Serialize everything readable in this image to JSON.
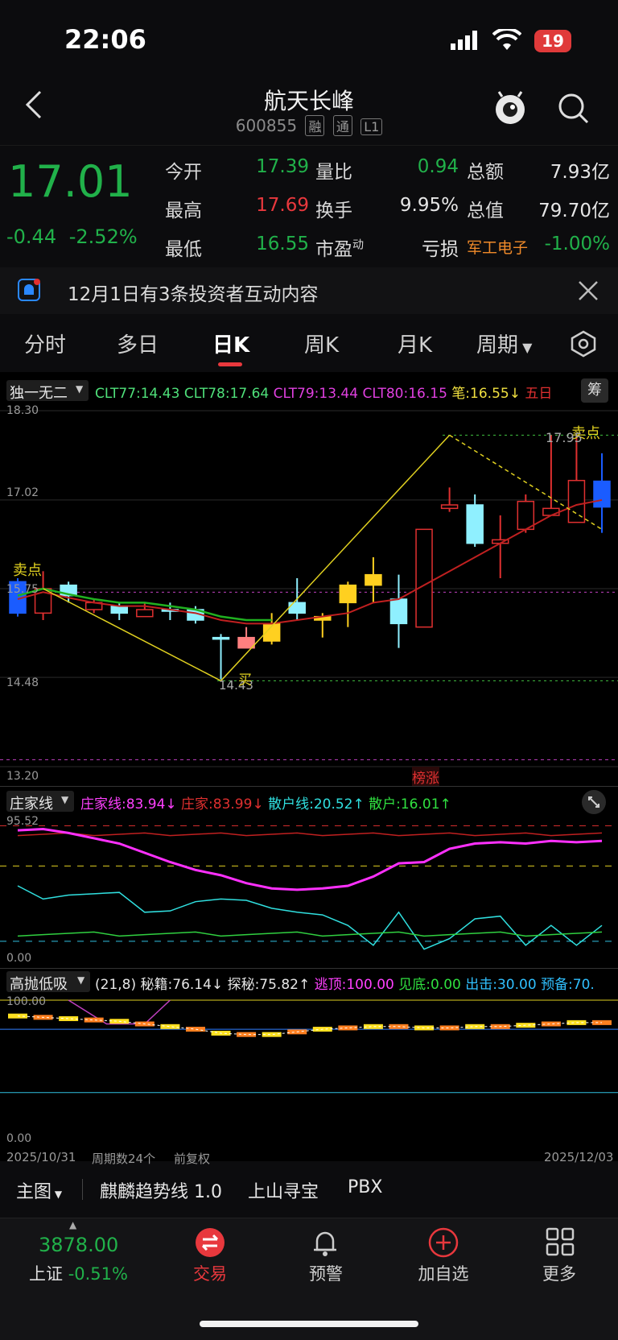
{
  "status": {
    "time": "22:06",
    "battery": "19"
  },
  "header": {
    "title": "航天长峰",
    "code": "600855",
    "tags": [
      "融",
      "通",
      "L1"
    ]
  },
  "quote": {
    "price": "17.01",
    "change": "-0.44",
    "change_pct": "-2.52%",
    "rows": [
      [
        {
          "label": "今开",
          "value": "17.39",
          "color": "green"
        },
        {
          "label": "量比",
          "value": "0.94",
          "color": "green"
        },
        {
          "label": "总额",
          "value": "7.93亿",
          "color": "white"
        }
      ],
      [
        {
          "label": "最高",
          "value": "17.69",
          "color": "red"
        },
        {
          "label": "换手",
          "value": "9.95%",
          "color": "white"
        },
        {
          "label": "总值",
          "value": "79.70亿",
          "color": "white"
        }
      ],
      [
        {
          "label": "最低",
          "value": "16.55",
          "color": "green"
        },
        {
          "label": "市盈",
          "sup": "动",
          "value": "亏损",
          "color": "white"
        },
        {
          "label": "军工电子",
          "value": "-1.00%",
          "color": "green"
        }
      ]
    ]
  },
  "notice": {
    "text": "12月1日有3条投资者互动内容"
  },
  "tabs": [
    "分时",
    "多日",
    "日K",
    "周K",
    "月K",
    "周期"
  ],
  "main_chart": {
    "indicator_name": "独一无二",
    "legend": [
      {
        "text": "CLT77:14.43",
        "color": "#4fe07a"
      },
      {
        "text": "CLT78:17.64",
        "color": "#4fe07a"
      },
      {
        "text": "CLT79:13.44",
        "color": "#e040e0"
      },
      {
        "text": "CLT80:16.15",
        "color": "#e040e0"
      },
      {
        "text": "笔:16.55↓",
        "color": "#f0e040"
      },
      {
        "text": "五日",
        "color": "#e03030"
      }
    ],
    "chip_btn": "筹",
    "y_labels": [
      "18.30",
      "17.02",
      "15.75",
      "14.48",
      "13.20"
    ],
    "annotations": {
      "sell1": "卖点",
      "sell2": "卖点",
      "high": "17.95",
      "low": "14.43",
      "buy": "买",
      "bang": "榜涨"
    }
  },
  "sub1": {
    "indicator_name": "庄家线",
    "legend": [
      {
        "text": "庄家线:83.94↓",
        "color": "#ff40ff"
      },
      {
        "text": "庄家:83.99↓",
        "color": "#e03030"
      },
      {
        "text": "散户线:20.52↑",
        "color": "#30e0e0"
      },
      {
        "text": "散户:16.01↑",
        "color": "#30e040"
      }
    ],
    "y_labels": [
      "95.52",
      "0.00"
    ]
  },
  "sub2": {
    "indicator_name": "高抛低吸",
    "legend": [
      {
        "text": "(21,8)",
        "color": "#e6e6e6"
      },
      {
        "text": "秘籍:76.14↓",
        "color": "#e6e6e6"
      },
      {
        "text": "探秘:75.82↑",
        "color": "#e6e6e6"
      },
      {
        "text": "逃顶:100.00",
        "color": "#ff40ff"
      },
      {
        "text": "见底:0.00",
        "color": "#30e040"
      },
      {
        "text": "出击:30.00",
        "color": "#30c0ff"
      },
      {
        "text": "预备:70.",
        "color": "#30c0ff"
      }
    ],
    "y_labels": [
      "100.00",
      "0.00"
    ]
  },
  "x_axis": {
    "start": "2025/10/31",
    "period": "周期数24个",
    "adjust": "前复权",
    "end": "2025/12/03"
  },
  "bottom_bar": {
    "main": "主图",
    "items": [
      "麒麟趋势线 1.0",
      "上山寻宝",
      "PBX"
    ]
  },
  "tabbar": {
    "index_value": "3878.00",
    "index_name": "上证",
    "index_change": "-0.51%",
    "items": [
      "交易",
      "预警",
      "加自选",
      "更多"
    ]
  },
  "chart_data": {
    "type": "candlestick",
    "ylim": [
      13.2,
      18.3
    ],
    "candles": [
      {
        "o": 15.4,
        "c": 15.85,
        "h": 15.9,
        "l": 15.35,
        "up": false
      },
      {
        "o": 15.75,
        "c": 15.4,
        "h": 16.0,
        "l": 15.3,
        "up": true
      },
      {
        "o": 15.65,
        "c": 15.8,
        "h": 15.85,
        "l": 15.55,
        "up": false
      },
      {
        "o": 15.55,
        "c": 15.45,
        "h": 15.6,
        "l": 15.4,
        "up": true
      },
      {
        "o": 15.5,
        "c": 15.4,
        "h": 15.55,
        "l": 15.3,
        "up": false
      },
      {
        "o": 15.45,
        "c": 15.35,
        "h": 15.55,
        "l": 15.35,
        "up": true
      },
      {
        "o": 15.45,
        "c": 15.45,
        "h": 15.55,
        "l": 15.3,
        "up": false
      },
      {
        "o": 15.45,
        "c": 15.3,
        "h": 15.5,
        "l": 15.25,
        "up": false
      },
      {
        "o": 15.05,
        "c": 15.05,
        "h": 15.1,
        "l": 14.45,
        "up": false
      },
      {
        "o": 14.9,
        "c": 15.05,
        "h": 15.2,
        "l": 14.9,
        "up": true
      },
      {
        "o": 15.0,
        "c": 15.25,
        "h": 15.4,
        "l": 14.95,
        "up": true
      },
      {
        "o": 15.4,
        "c": 15.55,
        "h": 15.9,
        "l": 15.3,
        "up": false
      },
      {
        "o": 15.3,
        "c": 15.35,
        "h": 15.4,
        "l": 15.05,
        "up": true
      },
      {
        "o": 15.55,
        "c": 15.8,
        "h": 15.85,
        "l": 15.2,
        "up": true
      },
      {
        "o": 15.8,
        "c": 15.95,
        "h": 16.2,
        "l": 15.55,
        "up": true
      },
      {
        "o": 15.6,
        "c": 15.25,
        "h": 15.95,
        "l": 14.9,
        "up": false
      },
      {
        "o": 15.2,
        "c": 16.6,
        "h": 16.6,
        "l": 15.2,
        "up": true
      },
      {
        "o": 16.9,
        "c": 16.95,
        "h": 17.2,
        "l": 16.85,
        "up": true
      },
      {
        "o": 16.95,
        "c": 16.4,
        "h": 17.1,
        "l": 16.35,
        "up": false
      },
      {
        "o": 16.45,
        "c": 16.4,
        "h": 16.8,
        "l": 15.9,
        "up": true
      },
      {
        "o": 16.6,
        "c": 17.0,
        "h": 17.1,
        "l": 16.55,
        "up": true
      },
      {
        "o": 16.8,
        "c": 16.9,
        "h": 17.95,
        "l": 16.8,
        "up": true
      },
      {
        "o": 16.7,
        "c": 17.3,
        "h": 17.95,
        "l": 16.7,
        "up": true
      },
      {
        "o": 17.29,
        "c": 16.92,
        "h": 17.69,
        "l": 16.55,
        "up": false
      }
    ],
    "ma5": [
      15.6,
      15.7,
      15.62,
      15.55,
      15.5,
      15.5,
      15.45,
      15.4,
      15.3,
      15.25,
      15.25,
      15.3,
      15.35,
      15.4,
      15.55,
      15.6,
      15.8,
      16.0,
      16.2,
      16.4,
      16.6,
      16.8,
      16.95,
      17.02
    ],
    "sub1_zhuang": [
      92,
      93,
      90,
      86,
      82,
      75,
      68,
      62,
      58,
      52,
      48,
      47,
      48,
      50,
      57,
      67,
      68,
      78,
      82,
      83,
      82,
      84,
      83,
      84
    ],
    "sub1_sanhu": [
      50,
      40,
      43,
      44,
      45,
      30,
      31,
      38,
      40,
      39,
      33,
      30,
      28,
      20,
      5,
      30,
      2,
      10,
      25,
      27,
      5,
      20,
      5,
      20
    ],
    "sub2_line": [
      88,
      87,
      86,
      85,
      84,
      82,
      80,
      78,
      75,
      74,
      74,
      76,
      78,
      79,
      80,
      80,
      79,
      79,
      80,
      80,
      81,
      82,
      83,
      83
    ]
  }
}
